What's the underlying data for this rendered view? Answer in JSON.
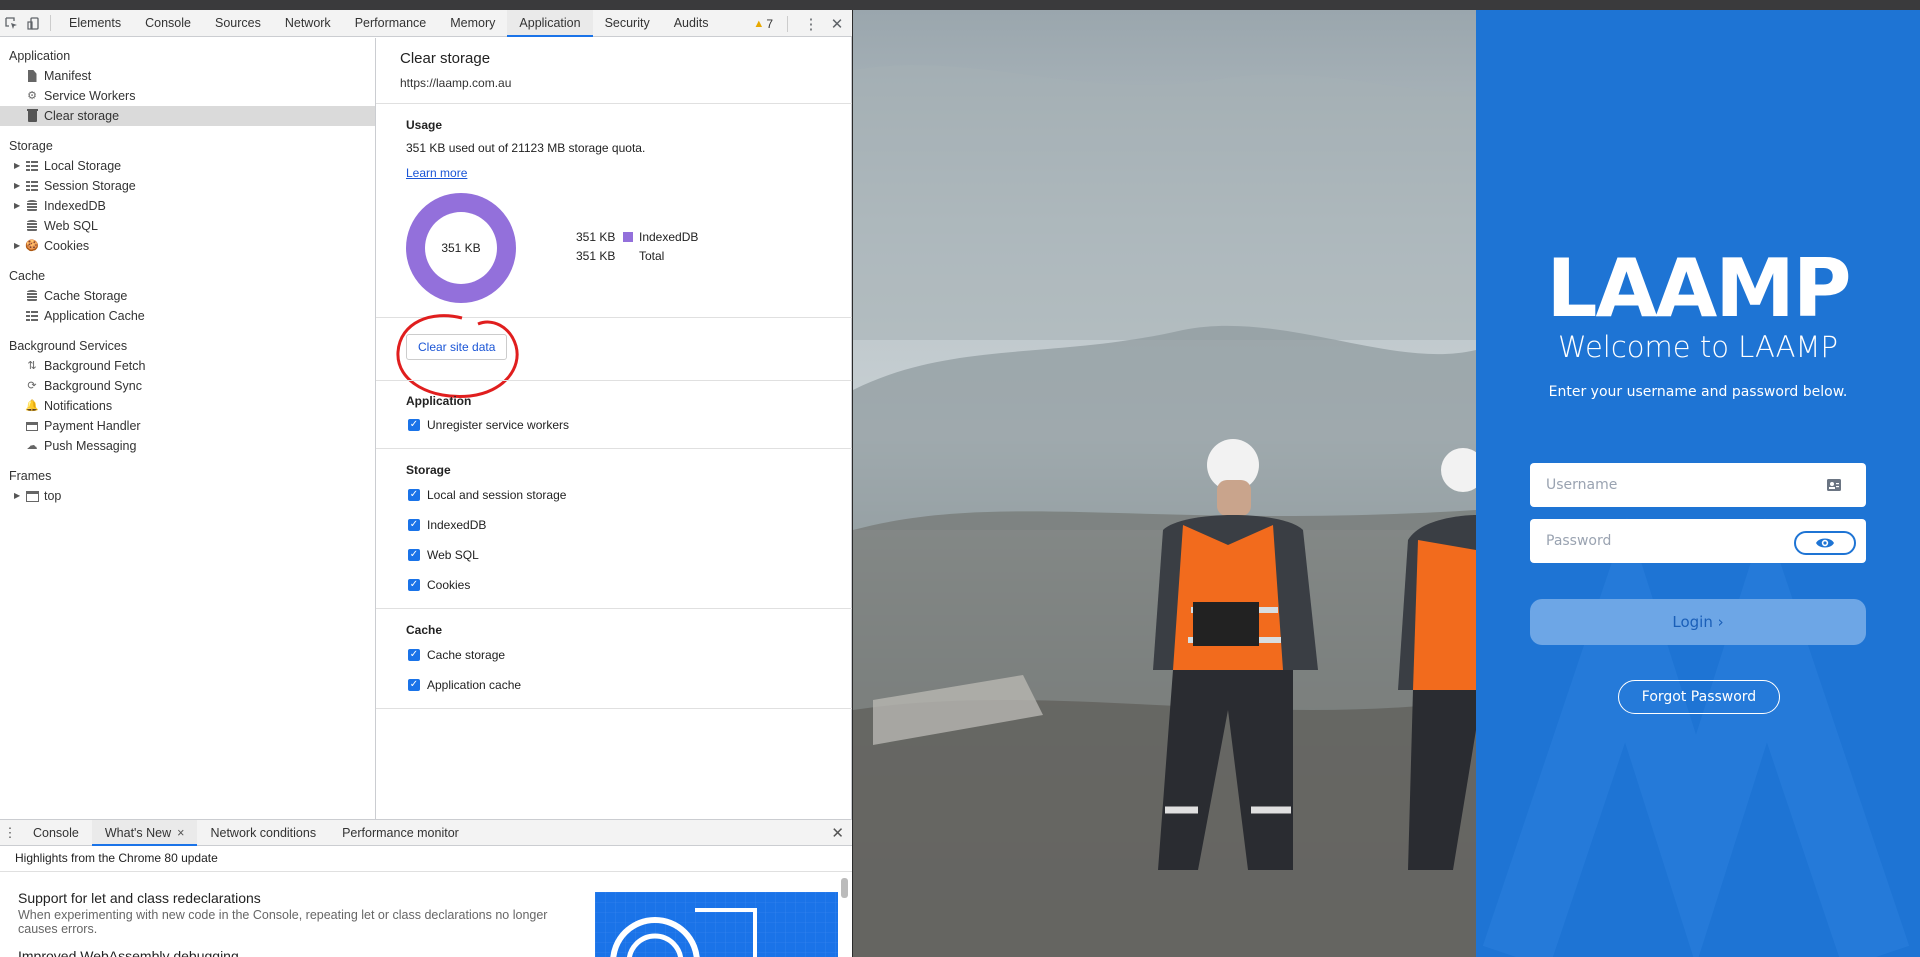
{
  "devtools": {
    "tabs": [
      "Elements",
      "Console",
      "Sources",
      "Network",
      "Performance",
      "Memory",
      "Application",
      "Security",
      "Audits"
    ],
    "active_tab": "Application",
    "warning_count": "7"
  },
  "sidebar": {
    "application": {
      "title": "Application",
      "items": [
        "Manifest",
        "Service Workers",
        "Clear storage"
      ]
    },
    "storage": {
      "title": "Storage",
      "items": [
        "Local Storage",
        "Session Storage",
        "IndexedDB",
        "Web SQL",
        "Cookies"
      ]
    },
    "cache": {
      "title": "Cache",
      "items": [
        "Cache Storage",
        "Application Cache"
      ]
    },
    "background": {
      "title": "Background Services",
      "items": [
        "Background Fetch",
        "Background Sync",
        "Notifications",
        "Payment Handler",
        "Push Messaging"
      ]
    },
    "frames": {
      "title": "Frames",
      "items": [
        "top"
      ]
    }
  },
  "main": {
    "title": "Clear storage",
    "origin": "https://laamp.com.au",
    "usage": {
      "heading": "Usage",
      "text": "351 KB used out of 21123 MB storage quota.",
      "learn_more": "Learn more",
      "donut_label": "351 KB",
      "legend": [
        {
          "value": "351 KB",
          "label": "IndexedDB",
          "color": "#9370db"
        },
        {
          "value": "351 KB",
          "label": "Total"
        }
      ]
    },
    "clear_button": "Clear site data",
    "application_section": {
      "heading": "Application",
      "checks": [
        "Unregister service workers"
      ]
    },
    "storage_section": {
      "heading": "Storage",
      "checks": [
        "Local and session storage",
        "IndexedDB",
        "Web SQL",
        "Cookies"
      ]
    },
    "cache_section": {
      "heading": "Cache",
      "checks": [
        "Cache storage",
        "Application cache"
      ]
    }
  },
  "drawer": {
    "tabs": [
      "Console",
      "What's New",
      "Network conditions",
      "Performance monitor"
    ],
    "active_tab": "What's New",
    "highlights": "Highlights from the Chrome 80 update",
    "article_title": "Support for let and class redeclarations",
    "article_text": "When experimenting with new code in the Console, repeating let or class declarations no longer causes errors.",
    "next_title": "Improved WebAssembly debugging"
  },
  "login": {
    "logo": "LAAMP",
    "title": "Welcome to LAAMP",
    "subtitle": "Enter your username and password below.",
    "username_placeholder": "Username",
    "password_placeholder": "Password",
    "login_button": "Login",
    "forgot_button": "Forgot Password",
    "brand_color": "#1e74d4"
  }
}
